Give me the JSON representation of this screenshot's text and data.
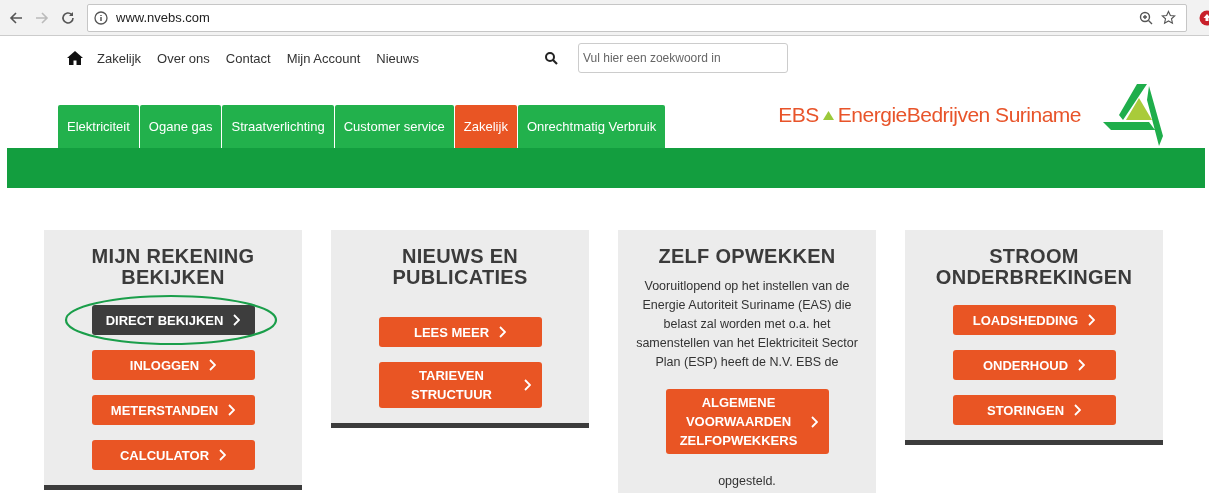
{
  "browser": {
    "url": "www.nvebs.com"
  },
  "top_nav": {
    "items": [
      "Zakelijk",
      "Over ons",
      "Contact",
      "Mijn Account",
      "Nieuws"
    ],
    "search": {
      "placeholder": "Vul hier een zoekwoord in"
    }
  },
  "logo": {
    "abbr": "EBS",
    "name": "EnergieBedrijven Suriname"
  },
  "tabs": [
    {
      "label": "Elektriciteit",
      "selected": false
    },
    {
      "label": "Ogane gas",
      "selected": false
    },
    {
      "label": "Straatverlichting",
      "selected": false
    },
    {
      "label": "Customer service",
      "selected": false
    },
    {
      "label": "Zakelijk",
      "selected": true
    },
    {
      "label": "Onrechtmatig Verbruik",
      "selected": false
    }
  ],
  "cards": [
    {
      "title": "MIJN REKENING BEKIJKEN",
      "buttons": [
        {
          "label": "DIRECT BEKIJKEN",
          "highlighted": true
        },
        {
          "label": "INLOGGEN",
          "highlighted": false
        },
        {
          "label": "METERSTANDEN",
          "highlighted": false
        },
        {
          "label": "CALCULATOR",
          "highlighted": false
        }
      ]
    },
    {
      "title": "NIEUWS EN PUBLICATIES",
      "buttons": [
        {
          "label": "LEES MEER",
          "highlighted": false
        },
        {
          "label": "TARIEVEN STRUCTUUR",
          "highlighted": false
        }
      ]
    },
    {
      "title": "ZELF OPWEKKEN",
      "body": "Vooruitlopend op het instellen van de Energie Autoriteit Suriname (EAS) die belast zal worden met o.a. het samenstellen van het Elektriciteit Sector Plan (ESP) heeft de N.V. EBS de",
      "buttons": [
        {
          "label": "ALGEMENE VOORWAARDEN ZELFOPWEKKERS",
          "highlighted": false
        }
      ],
      "footer": "opgesteld."
    },
    {
      "title": "STROOM ONDERBREKINGEN",
      "buttons": [
        {
          "label": "LOADSHEDDING",
          "highlighted": false
        },
        {
          "label": "ONDERHOUD",
          "highlighted": false
        },
        {
          "label": "STORINGEN",
          "highlighted": false
        }
      ]
    }
  ]
}
